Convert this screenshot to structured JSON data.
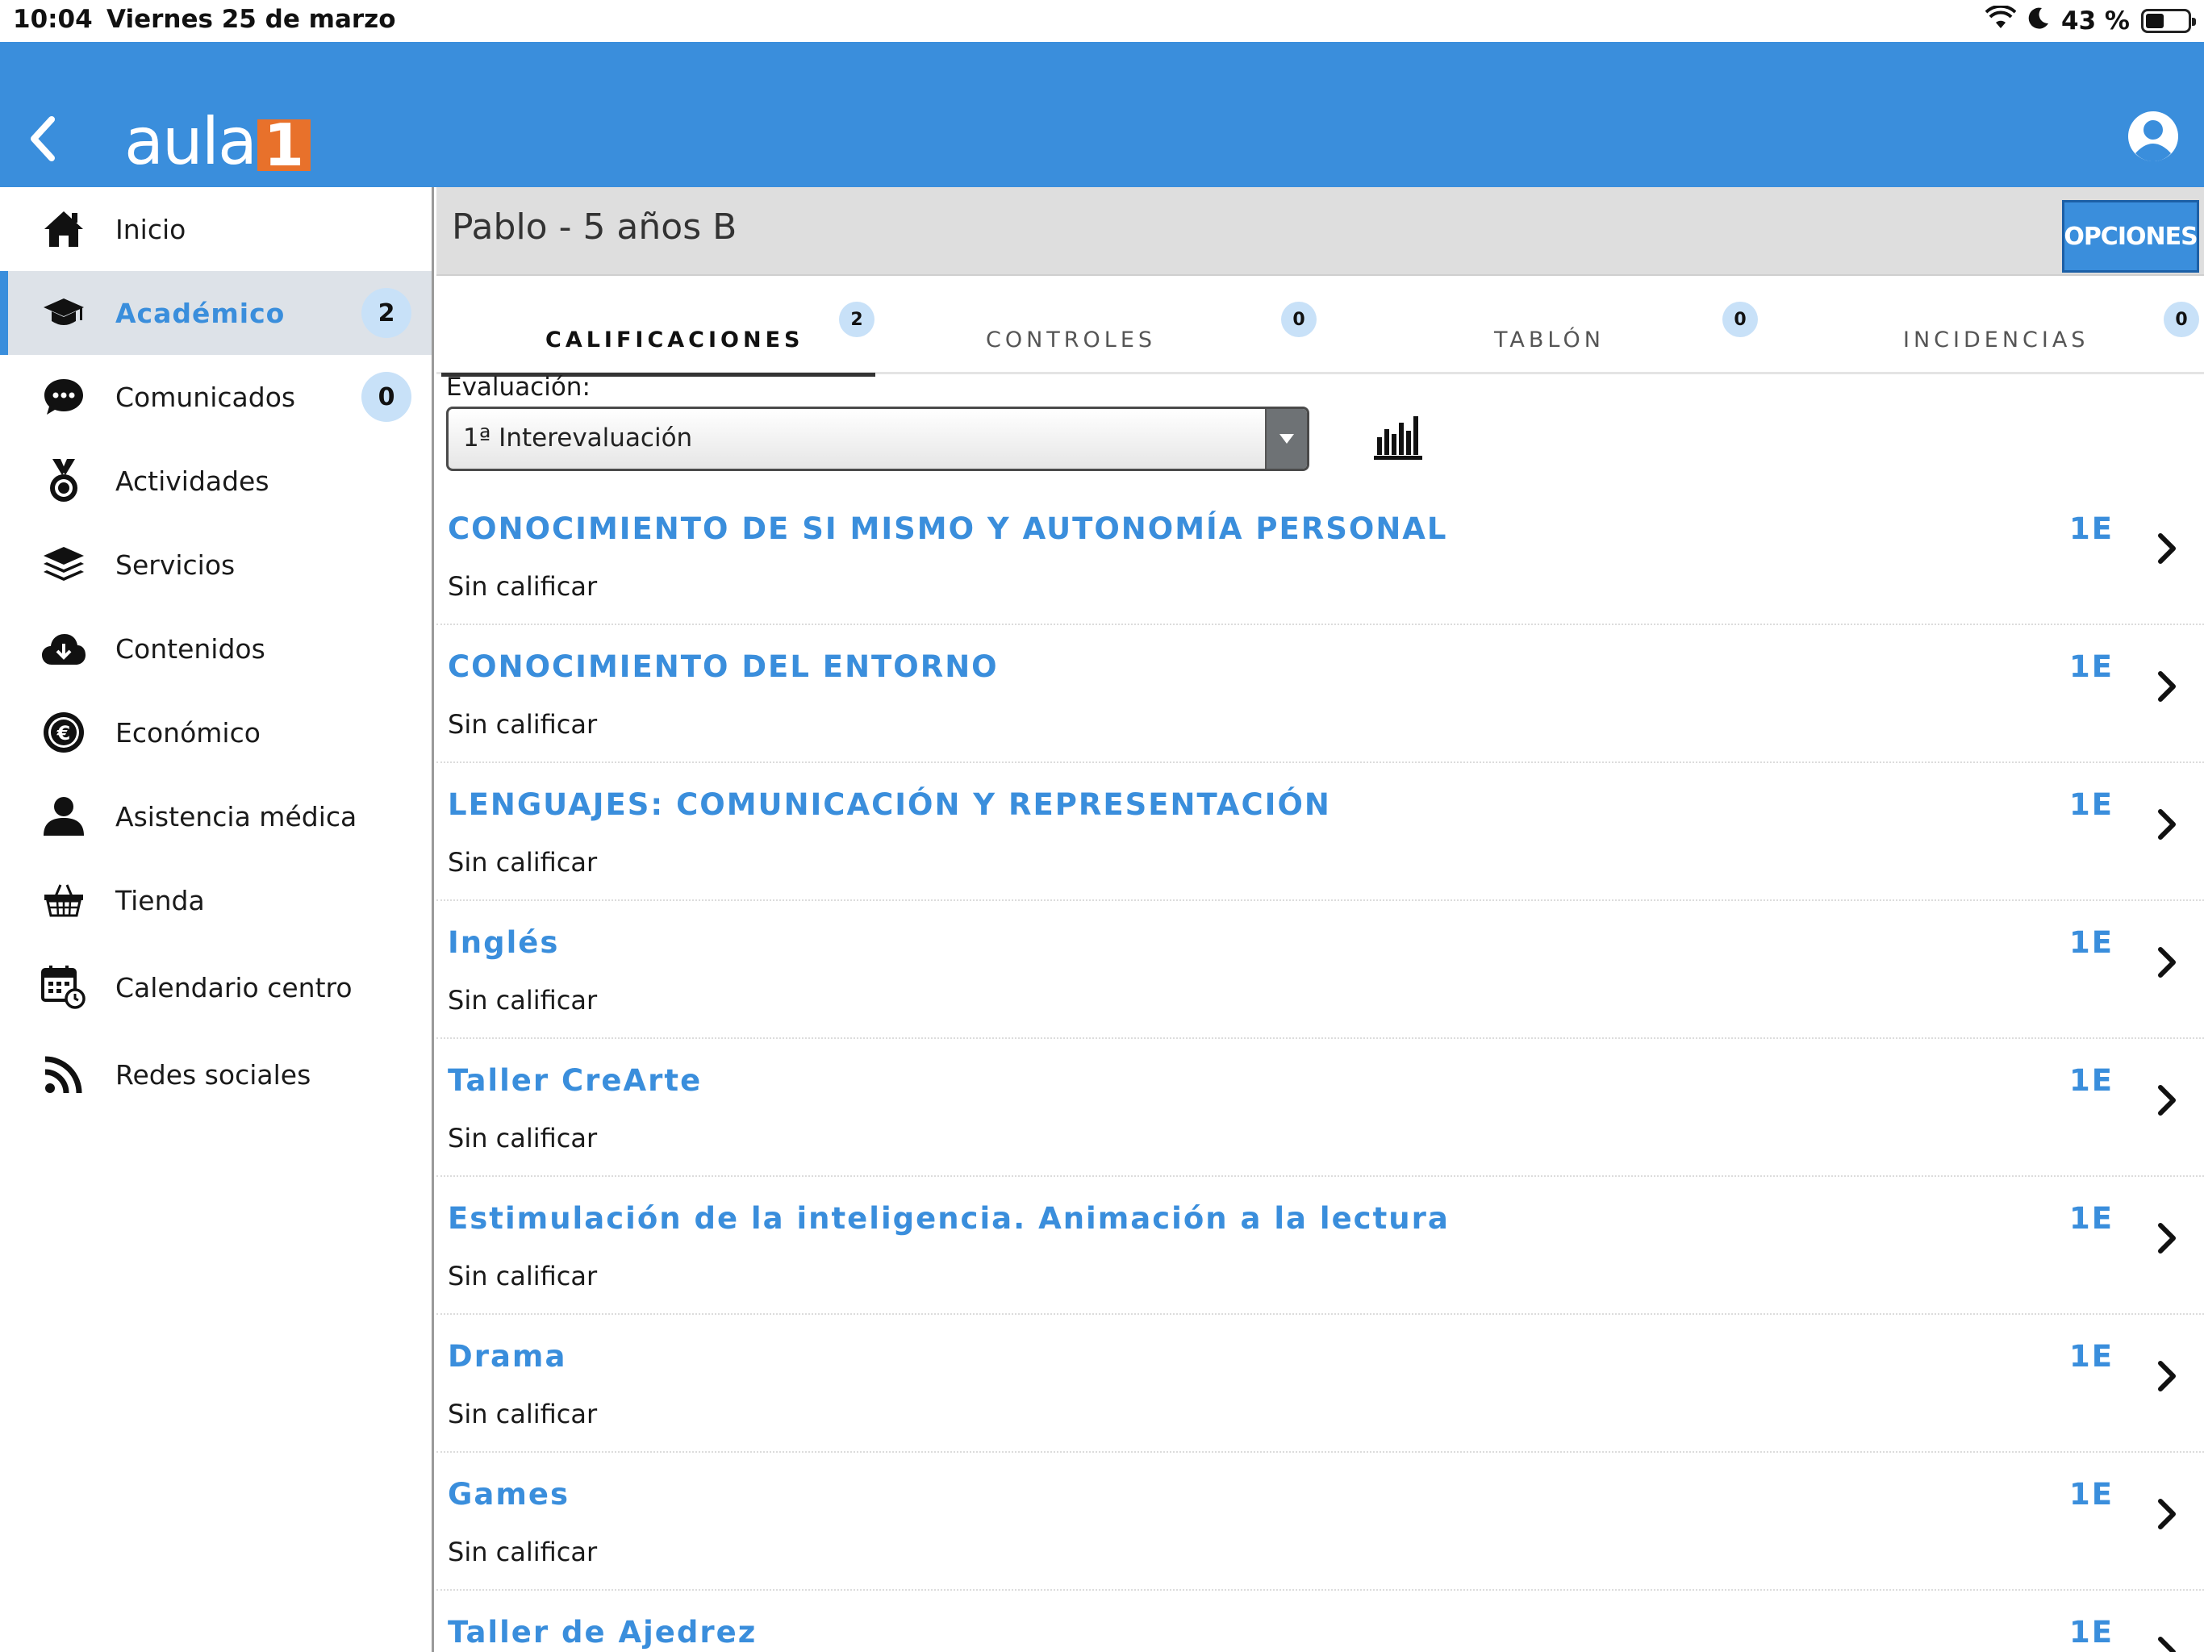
{
  "status_bar": {
    "time": "10:04",
    "date": "Viernes 25 de marzo",
    "battery": "43 %",
    "battery_level": 0.43
  },
  "header": {
    "logo_text": "aula",
    "logo_digit": "1",
    "accent_color": "#3a8edc",
    "logo_color": "#e8712b"
  },
  "sidebar": {
    "items": [
      {
        "label": "Inicio",
        "icon": "home-icon"
      },
      {
        "label": "Académico",
        "icon": "graduation-cap-icon",
        "badge": "2",
        "active": true
      },
      {
        "label": "Comunicados",
        "icon": "chat-bubble-icon",
        "badge": "0"
      },
      {
        "label": "Actividades",
        "icon": "medal-icon"
      },
      {
        "label": "Servicios",
        "icon": "layers-icon"
      },
      {
        "label": "Contenidos",
        "icon": "cloud-download-icon"
      },
      {
        "label": "Económico",
        "icon": "euro-icon"
      },
      {
        "label": "Asistencia médica",
        "icon": "person-icon"
      },
      {
        "label": "Tienda",
        "icon": "basket-icon"
      },
      {
        "label": "Calendario centro",
        "icon": "calendar-icon"
      },
      {
        "label": "Redes sociales",
        "icon": "rss-icon"
      }
    ]
  },
  "main": {
    "student": "Pablo - 5 años B",
    "options_label": "OPCIONES",
    "tabs": [
      {
        "label": "CALIFICACIONES",
        "badge": "2",
        "active": true
      },
      {
        "label": "CONTROLES",
        "badge": "0"
      },
      {
        "label": "TABLÓN",
        "badge": "0"
      },
      {
        "label": "INCIDENCIAS",
        "badge": "0"
      }
    ],
    "evaluation_label": "Evaluación:",
    "evaluation_value": "1ª Interevaluación",
    "subjects": [
      {
        "title": "CONOCIMIENTO DE SI MISMO Y AUTONOMÍA PERSONAL",
        "status": "Sin calificar",
        "code": "1E"
      },
      {
        "title": "CONOCIMIENTO DEL ENTORNO",
        "status": "Sin calificar",
        "code": "1E"
      },
      {
        "title": "LENGUAJES: COMUNICACIÓN Y REPRESENTACIÓN",
        "status": "Sin calificar",
        "code": "1E"
      },
      {
        "title": "Inglés",
        "status": "Sin calificar",
        "code": "1E"
      },
      {
        "title": "Taller CreArte",
        "status": "Sin calificar",
        "code": "1E"
      },
      {
        "title": "Estimulación de la inteligencia. Animación a la lectura",
        "status": "Sin calificar",
        "code": "1E"
      },
      {
        "title": "Drama",
        "status": "Sin calificar",
        "code": "1E"
      },
      {
        "title": "Games",
        "status": "Sin calificar",
        "code": "1E"
      },
      {
        "title": "Taller de Ajedrez",
        "status": "",
        "code": "1E"
      }
    ]
  }
}
